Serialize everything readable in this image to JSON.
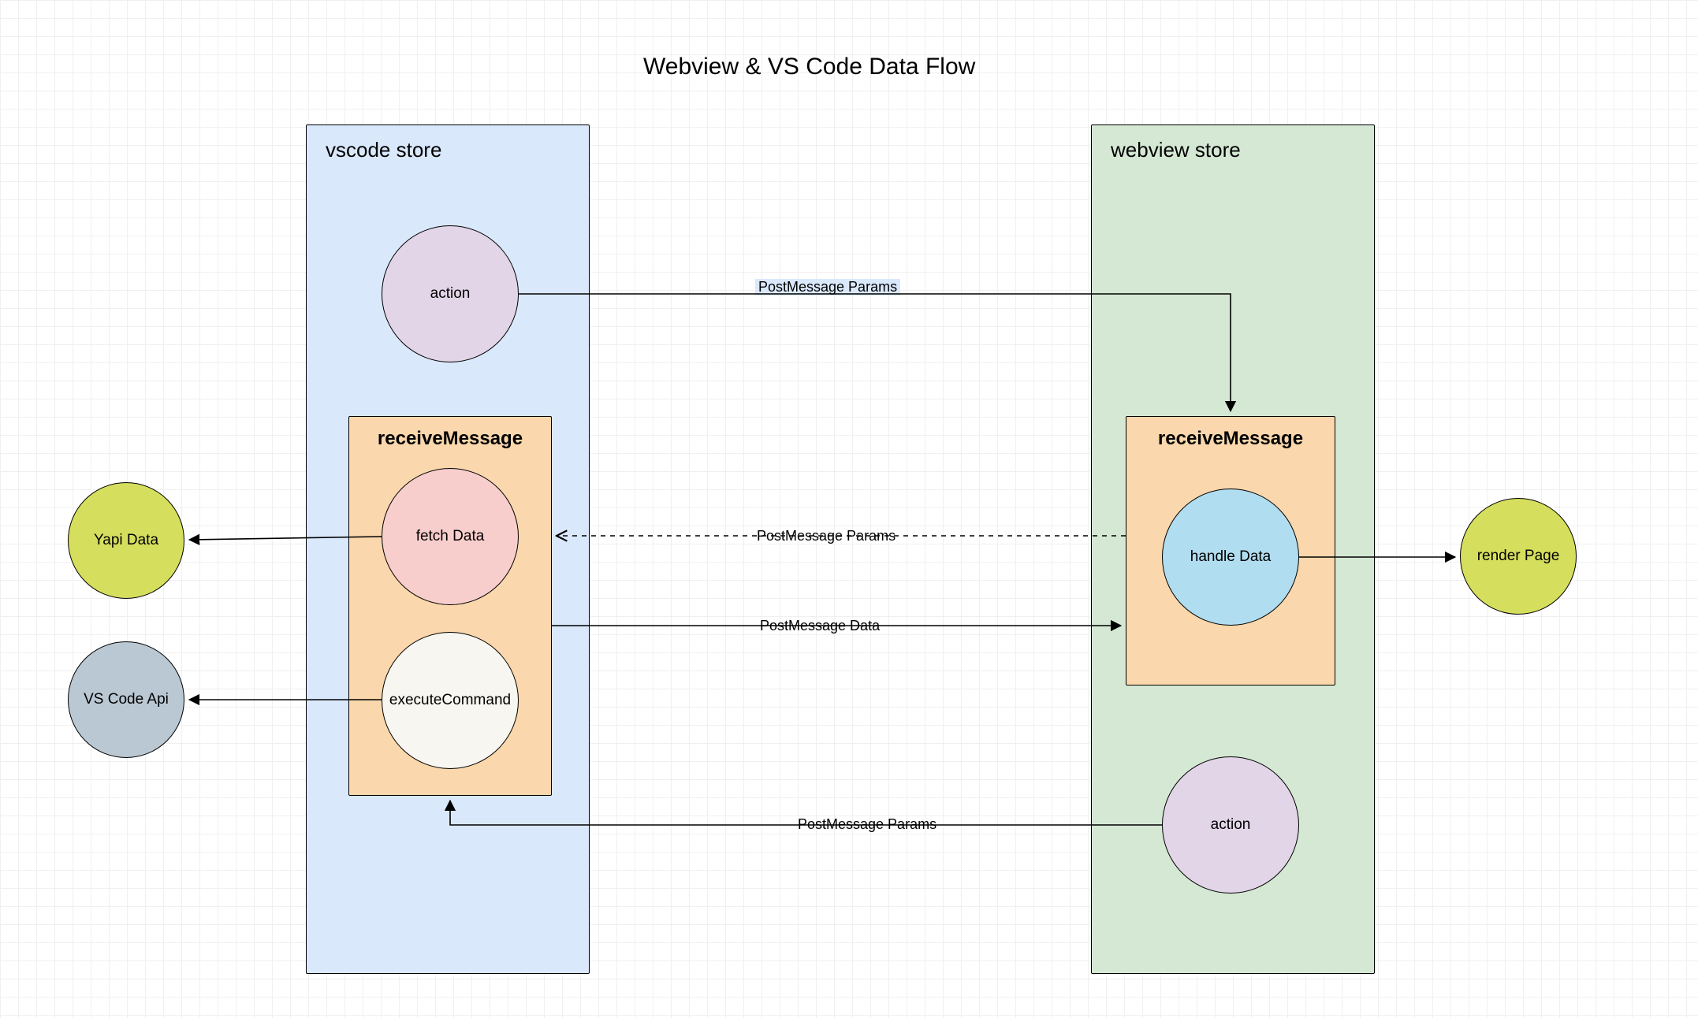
{
  "title": "Webview & VS Code Data Flow",
  "stores": {
    "vscode": {
      "label": "vscode store"
    },
    "webview": {
      "label": "webview store"
    }
  },
  "boxes": {
    "vscode_receive": {
      "label": "receiveMessage"
    },
    "webview_receive": {
      "label": "receiveMessage"
    }
  },
  "nodes": {
    "vscode_action": "action",
    "fetch_data": "fetch Data",
    "execute_command": "executeCommand",
    "yapi_data": "Yapi Data",
    "vscode_api": "VS Code Api",
    "handle_data": "handle Data",
    "webview_action": "action",
    "render_page": "render Page"
  },
  "edges": {
    "pm_params_1": "PostMessage Params",
    "pm_params_2": "PostMessage Params",
    "pm_data": "PostMessage Data",
    "pm_params_3": "PostMessage Params"
  },
  "colors": {
    "vscode_store_fill": "#dae8fc",
    "webview_store_fill": "#d5e8d4",
    "inner_box_fill": "#fad7ac",
    "action_fill": "#e1d5e7",
    "fetch_fill": "#f8cecc",
    "execute_fill": "#f8f6f0",
    "green_fill": "#d6df5d",
    "grey_fill": "#bac8d3",
    "handle_fill": "#b1ddf0"
  }
}
